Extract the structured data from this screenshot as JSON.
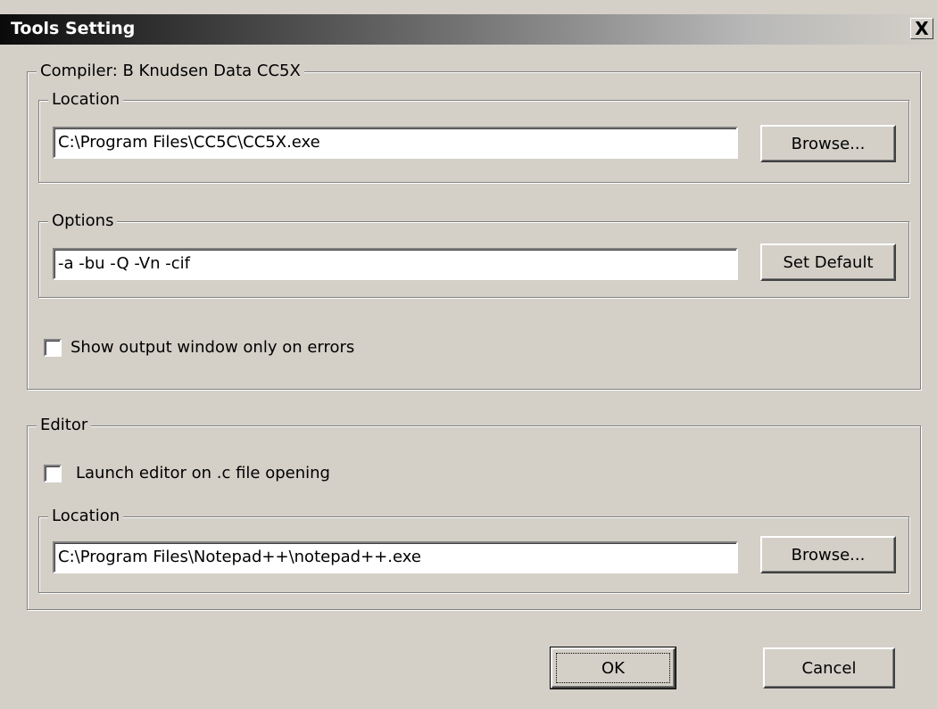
{
  "window": {
    "title": "Tools Setting",
    "close_glyph": "X"
  },
  "compiler": {
    "group_label": "Compiler: B Knudsen Data CC5X",
    "location_label": "Location",
    "location_value": "C:\\Program Files\\CC5C\\CC5X.exe",
    "browse_label": "Browse...",
    "options_label": "Options",
    "options_value": "-a -bu -Q -Vn -cif",
    "set_default_label": "Set Default",
    "show_output_label": "Show output window only on errors",
    "show_output_checked": false
  },
  "editor": {
    "group_label": "Editor",
    "launch_label": "Launch editor on .c file opening",
    "launch_checked": false,
    "location_label": "Location",
    "location_value": "C:\\Program Files\\Notepad++\\notepad++.exe",
    "browse_label": "Browse..."
  },
  "footer": {
    "ok_label": "OK",
    "cancel_label": "Cancel"
  },
  "colors": {
    "face": "#d4d0c8",
    "shadow": "#808080",
    "highlight": "#ffffff"
  }
}
